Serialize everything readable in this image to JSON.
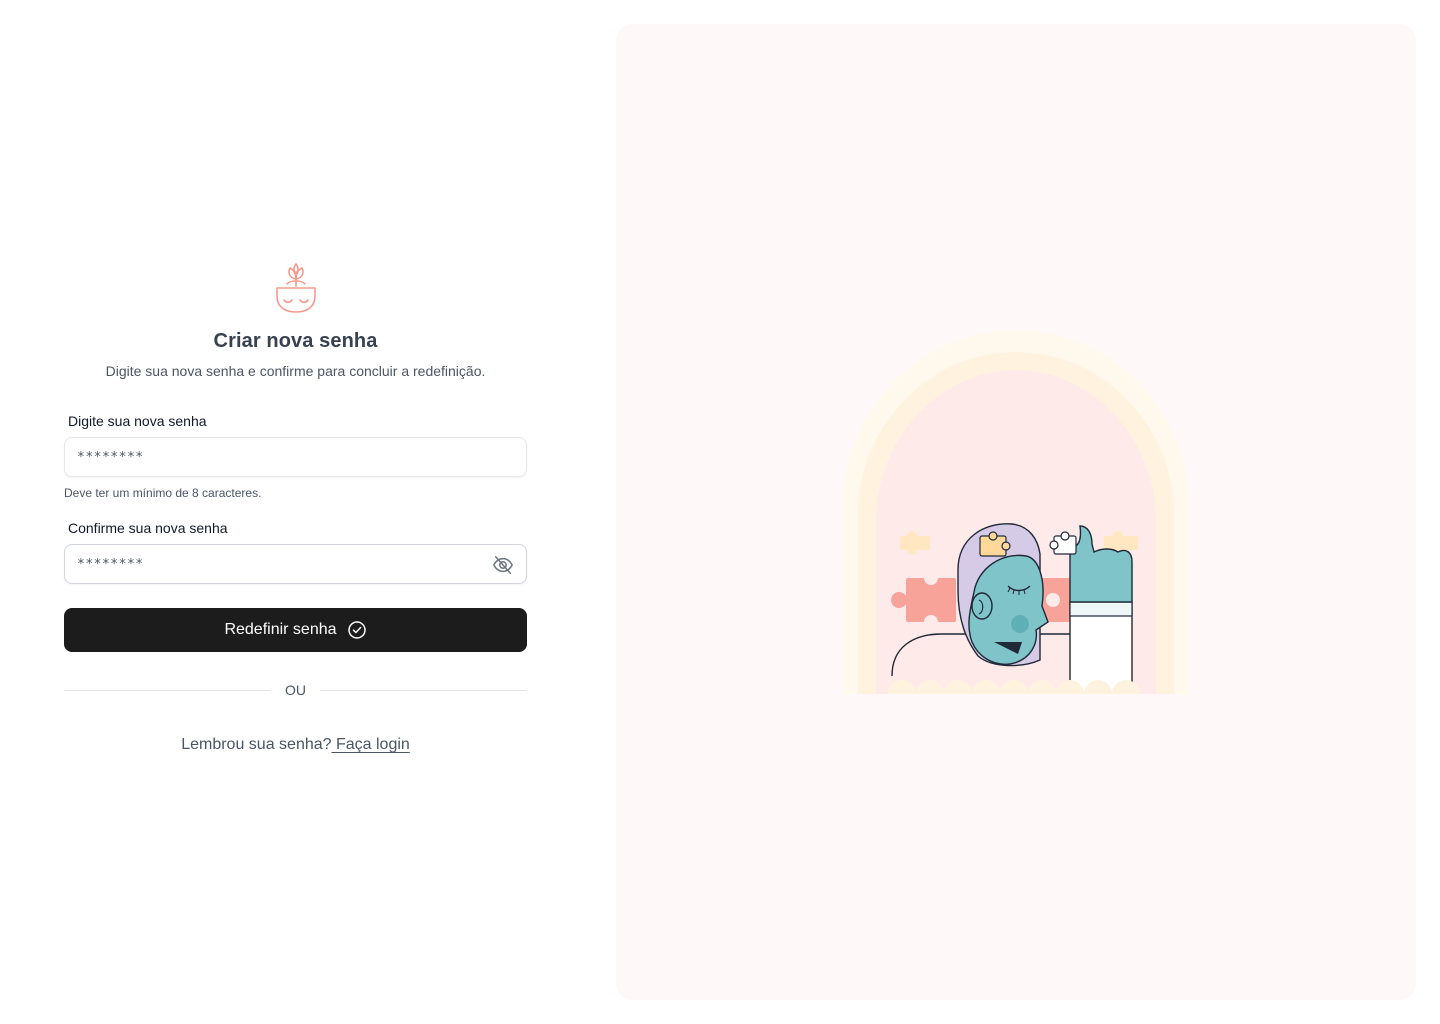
{
  "brand": {
    "logo": "plant-pot-logo",
    "accent_color": "#f49a8c"
  },
  "header": {
    "title": "Criar nova senha",
    "subtitle": "Digite sua nova senha e confirme para concluir a redefinição."
  },
  "form": {
    "new_password": {
      "label": "Digite sua nova senha",
      "value": "********",
      "hint": "Deve ter um mínimo de 8 caracteres."
    },
    "confirm_password": {
      "label": "Confirme sua nova senha",
      "value": "********",
      "toggle_icon": "eye-off-icon"
    },
    "submit": {
      "label": "Redefinir senha",
      "icon": "check-circle-icon"
    }
  },
  "divider": {
    "label": "OU"
  },
  "footer": {
    "text": "Lembrou sua senha?",
    "link_label": " Faça login"
  },
  "illustration": {
    "subject": "person-with-puzzle-pieces"
  }
}
